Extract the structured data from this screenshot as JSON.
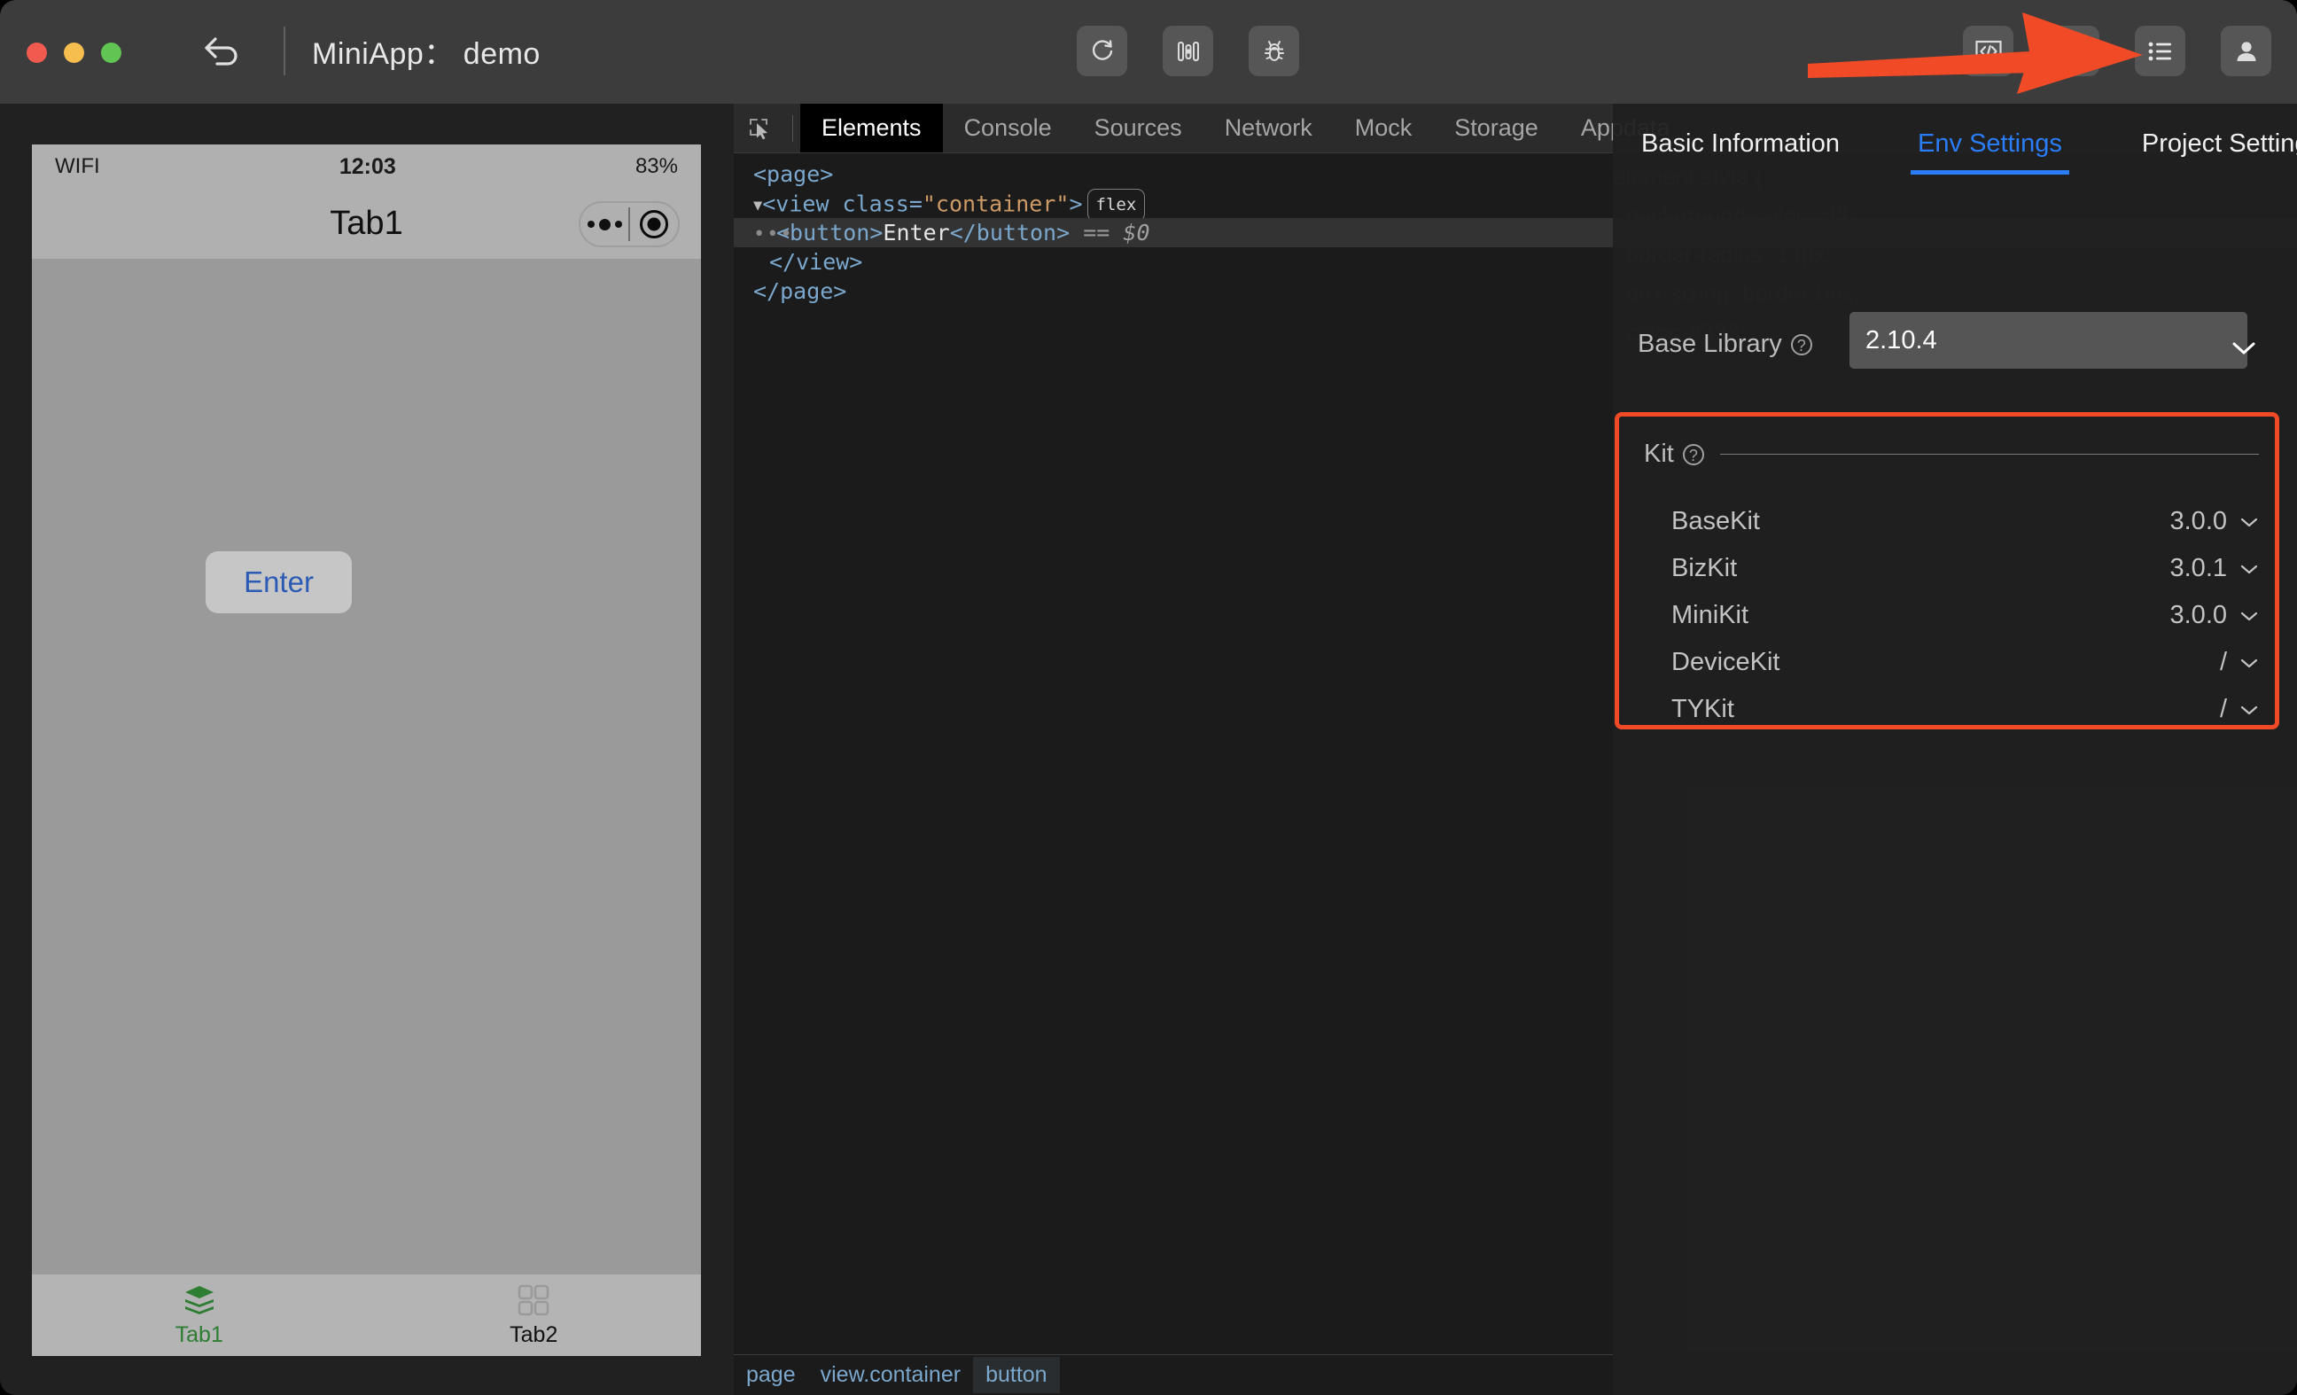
{
  "window": {
    "title_prefix": "MiniApp：",
    "title_name": "demo",
    "title_full": "MiniApp： demo",
    "traffic_lights": [
      "close",
      "minimize",
      "zoom"
    ],
    "colors": {
      "close": "#f05a4f",
      "minimize": "#f6bd4f",
      "zoom": "#61c554",
      "titlebar_bg": "#3c3c3c",
      "accent_blue": "#2a7cf7",
      "annotation_red": "#f04a26"
    }
  },
  "toolbar": {
    "back_icon": "back-arrow-icon",
    "center_buttons": [
      {
        "icon": "refresh-icon",
        "name": "refresh-button"
      },
      {
        "icon": "sliders-icon",
        "name": "settings-sliders-button"
      },
      {
        "icon": "bug-icon",
        "name": "debug-button"
      }
    ],
    "right_buttons": [
      {
        "icon": "code-preview-icon",
        "name": "code-preview-button"
      },
      {
        "icon": "upload-icon",
        "name": "upload-button"
      },
      {
        "icon": "list-details-icon",
        "name": "details-panel-button"
      },
      {
        "icon": "user-avatar-icon",
        "name": "account-button"
      }
    ]
  },
  "simulator": {
    "statusbar": {
      "network": "WIFI",
      "time": "12:03",
      "battery": "83%"
    },
    "navbar": {
      "title": "Tab1",
      "capsule_menu_icon": "more-dots-icon",
      "capsule_target_icon": "target-circle-icon"
    },
    "page": {
      "button_label": "Enter"
    },
    "tabbar": [
      {
        "label": "Tab1",
        "icon": "layers-icon",
        "active": true
      },
      {
        "label": "Tab2",
        "icon": "grid-icon",
        "active": false
      }
    ]
  },
  "devtools": {
    "picker_icon": "element-picker-icon",
    "tabs": [
      {
        "label": "Elements",
        "active": true
      },
      {
        "label": "Console",
        "active": false
      },
      {
        "label": "Sources",
        "active": false
      },
      {
        "label": "Network",
        "active": false
      },
      {
        "label": "Mock",
        "active": false
      },
      {
        "label": "Storage",
        "active": false
      },
      {
        "label": "Appdata",
        "active": false
      }
    ],
    "dom": {
      "line1": "<page>",
      "line2_tag": "<view class=\"container\">",
      "line2_open": "<view class=",
      "line2_attr": "\"container\"",
      "line2_close": ">",
      "badge": "flex",
      "line3_open": "<button>",
      "line3_text": "Enter",
      "line3_close": "</button>",
      "line3_eq": "==",
      "line3_ref": "$0",
      "line4": "</view>",
      "line5": "</page>"
    },
    "breadcrumb": [
      {
        "label": "page",
        "active": false
      },
      {
        "label": "view.container",
        "active": false
      },
      {
        "label": "button",
        "active": true
      }
    ],
    "ghost_styles": "element.style {\n  background-color: #fff;\n  border-radius: 14px;\n  box-sizing: border-box;\n  color: #333;"
  },
  "right_panel": {
    "tabs": [
      {
        "label": "Basic Information",
        "active": false
      },
      {
        "label": "Env Settings",
        "active": true
      },
      {
        "label": "Project Settings",
        "active": false
      }
    ],
    "base_library": {
      "label": "Base Library",
      "help_icon": "question-mark-icon",
      "value": "2.10.4",
      "chevron_icon": "chevron-down-icon"
    },
    "kit": {
      "title": "Kit",
      "help_icon": "question-mark-icon",
      "items": [
        {
          "name": "BaseKit",
          "version": "3.0.0"
        },
        {
          "name": "BizKit",
          "version": "3.0.1"
        },
        {
          "name": "MiniKit",
          "version": "3.0.0"
        },
        {
          "name": "DeviceKit",
          "version": "/"
        },
        {
          "name": "TYKit",
          "version": "/"
        }
      ]
    }
  },
  "annotation": {
    "type": "red-arrow",
    "points_to": "details-panel-button",
    "color": "#f04a26"
  }
}
